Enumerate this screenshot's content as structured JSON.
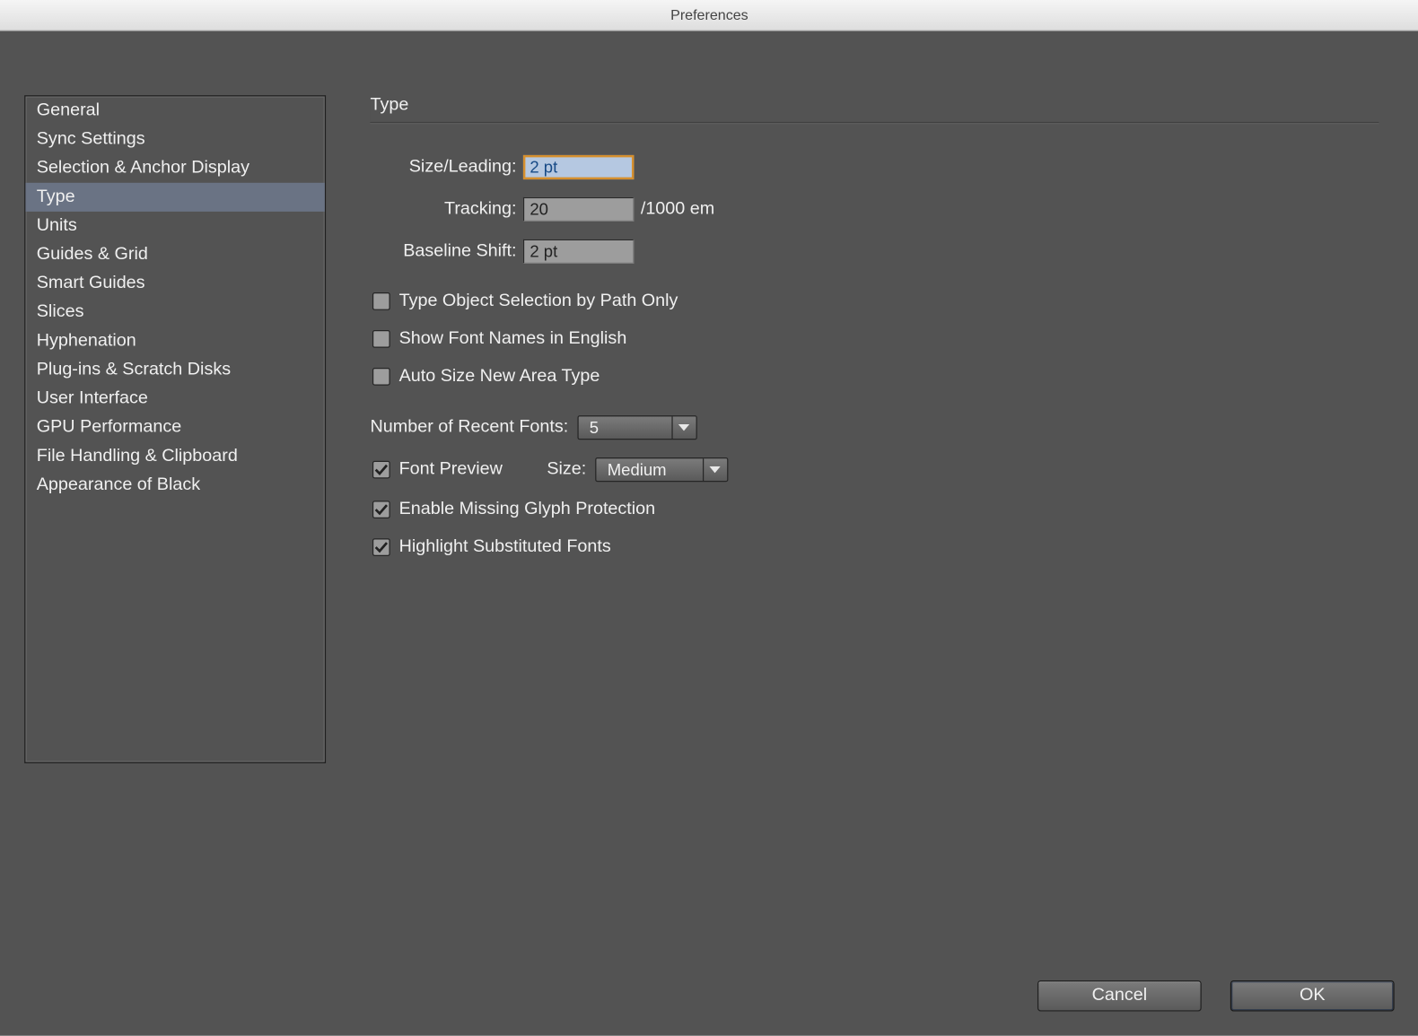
{
  "window": {
    "title": "Preferences"
  },
  "sidebar": {
    "items": [
      {
        "label": "General"
      },
      {
        "label": "Sync Settings"
      },
      {
        "label": "Selection & Anchor Display"
      },
      {
        "label": "Type",
        "selected": true
      },
      {
        "label": "Units"
      },
      {
        "label": "Guides & Grid"
      },
      {
        "label": "Smart Guides"
      },
      {
        "label": "Slices"
      },
      {
        "label": "Hyphenation"
      },
      {
        "label": "Plug-ins & Scratch Disks"
      },
      {
        "label": "User Interface"
      },
      {
        "label": "GPU Performance"
      },
      {
        "label": "File Handling & Clipboard"
      },
      {
        "label": "Appearance of Black"
      }
    ]
  },
  "section": {
    "title": "Type",
    "size_leading": {
      "label": "Size/Leading:",
      "value": "2 pt"
    },
    "tracking": {
      "label": "Tracking:",
      "value": "20",
      "suffix": "/1000 em"
    },
    "baseline_shift": {
      "label": "Baseline Shift:",
      "value": "2 pt"
    },
    "opt_path_only": {
      "label": "Type Object Selection by Path Only",
      "checked": false
    },
    "opt_english": {
      "label": "Show Font Names in English",
      "checked": false
    },
    "opt_autosize": {
      "label": "Auto Size New Area Type",
      "checked": false
    },
    "recent_fonts": {
      "label": "Number of Recent Fonts:",
      "value": "5"
    },
    "font_preview": {
      "label": "Font Preview",
      "checked": true,
      "size_label": "Size:",
      "size_value": "Medium"
    },
    "opt_glyph": {
      "label": "Enable Missing Glyph Protection",
      "checked": true
    },
    "opt_subst": {
      "label": "Highlight Substituted Fonts",
      "checked": true
    }
  },
  "buttons": {
    "cancel": "Cancel",
    "ok": "OK"
  }
}
